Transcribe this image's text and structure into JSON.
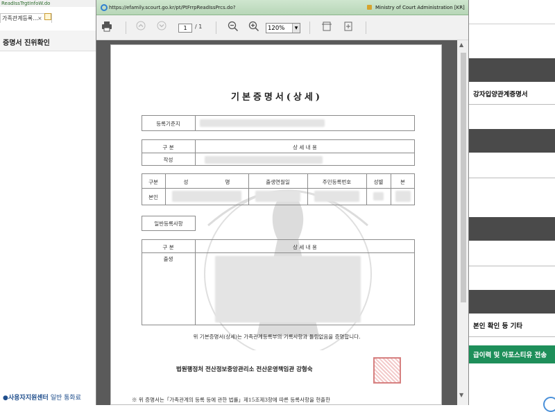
{
  "background": {
    "url_fragment": "ReadIssTrgtInfoW.do",
    "tab_label": "가족관계등록...",
    "tab_close": "×",
    "header": "증명서 진위확인",
    "right_items": [
      "강자입양관계증명서",
      "본인 확인 등 기타"
    ],
    "green_bar": "급이력 및 아포스티유 전송",
    "support_label": "사용자지원센터",
    "support_sub": "일반 통화료"
  },
  "popup": {
    "url": "https://efamily.scourt.go.kr/pt/PtFrrpReadIssPrcs.do?",
    "org": "Ministry of Court Administration [KR]"
  },
  "toolbar": {
    "print_icon": "printer-icon",
    "page_current": "1",
    "page_total": "/ 1",
    "zoom": "120%"
  },
  "document": {
    "title": "기본증명서(상세)",
    "registry_label": "등록기준지",
    "section_header_left": "구 분",
    "section_header_right": "상 세 내 용",
    "row_created": "작성",
    "columns": [
      "구분",
      "성",
      "명",
      "출생연월일",
      "주민등록번호",
      "성별",
      "본"
    ],
    "row_self": "본인",
    "general_label": "일반등록사항",
    "detail_header_left": "구 분",
    "detail_header_right": "상 세 내 용",
    "row_birth": "출생",
    "certify_text": "위 기본증명서(상세)는 가족관계등록부의 기록사항과 틀림없음을 증명합니다.",
    "issuer": "법원행정처 전산정보중앙관리소 전산운영책임관 강형숙",
    "note": "※ 위 증명서는「가족관계의 등록 등에 관한 법률」제15조제3항에 따른 등록사항을 현출한"
  }
}
